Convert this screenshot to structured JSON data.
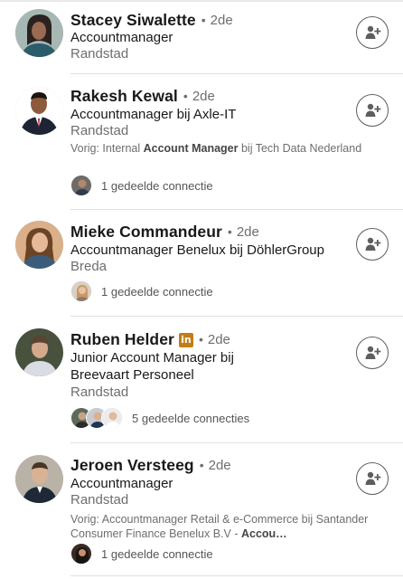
{
  "people": [
    {
      "name": "Stacey Siwalette",
      "degree": "2de",
      "headline": "Accountmanager",
      "location": "Randstad"
    },
    {
      "name": "Rakesh Kewal",
      "degree": "2de",
      "headline": "Accountmanager bij Axle-IT",
      "location": "Randstad",
      "previous": {
        "prefix": "Vorig: Internal ",
        "bold": "Account Manager",
        "suffix": "  bij Tech Data Nederland"
      },
      "shared": "1 gedeelde connectie"
    },
    {
      "name": "Mieke Commandeur",
      "degree": "2de",
      "headline": "Accountmanager Benelux bij DöhlerGroup",
      "location": "Breda",
      "shared": "1 gedeelde connectie"
    },
    {
      "name": "Ruben Helder",
      "linkedin_badge": "in",
      "degree": "2de",
      "headline_line1": "Junior Account Manager bij",
      "headline_line2": "Breevaart Personeel",
      "location": "Randstad",
      "shared": "5 gedeelde connecties"
    },
    {
      "name": "Jeroen Versteeg",
      "degree": "2de",
      "headline": "Accountmanager",
      "location": "Randstad",
      "previous": {
        "prefix": "Vorig: Accountmanager Retail & e-Commerce  bij Santander Consumer Finance Benelux B.V - ",
        "bold": "Accou…",
        "suffix": ""
      },
      "shared": "1 gedeelde connectie"
    }
  ],
  "dot": "•",
  "colors": {
    "badge": "#c37d16",
    "secondary_text": "#6e6e6e",
    "divider": "#e0e0e0"
  },
  "icons": {
    "connect": "add-person-icon"
  }
}
